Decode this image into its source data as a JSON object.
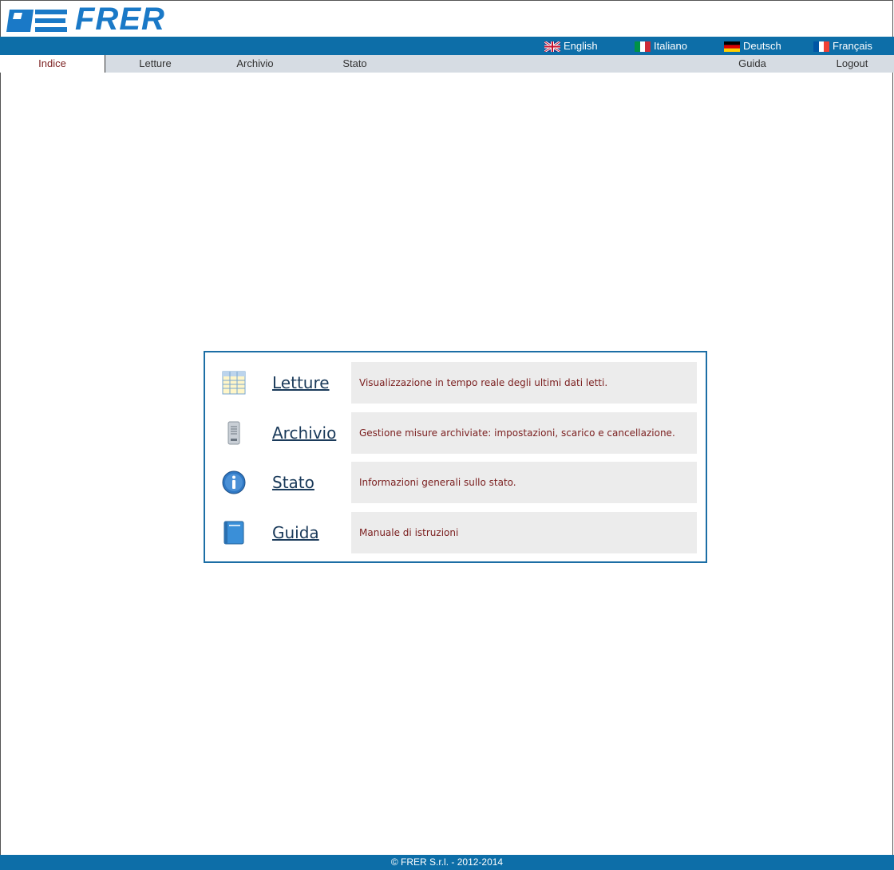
{
  "brand": {
    "logo_text": "FRER"
  },
  "languages": [
    {
      "label": "English"
    },
    {
      "label": "Italiano"
    },
    {
      "label": "Deutsch"
    },
    {
      "label": "Français"
    }
  ],
  "nav": {
    "left": [
      "Indice",
      "Letture",
      "Archivio",
      "Stato"
    ],
    "right": [
      "Guida",
      "Logout"
    ],
    "active": "Indice"
  },
  "menu": [
    {
      "title": "Letture",
      "description": "Visualizzazione in tempo reale degli ultimi dati letti.",
      "icon": "table-icon"
    },
    {
      "title": "Archivio",
      "description": "Gestione misure archiviate: impostazioni, scarico e cancellazione.",
      "icon": "server-icon"
    },
    {
      "title": "Stato",
      "description": "Informazioni generali sullo stato.",
      "icon": "info-icon"
    },
    {
      "title": "Guida",
      "description": "Manuale di istruzioni",
      "icon": "book-icon"
    }
  ],
  "footer": {
    "text": "© FRER S.r.l. - 2012-2014"
  },
  "colors": {
    "accent": "#0d6ea8",
    "nav_bg": "#d6dce3",
    "desc_text": "#7a1e1e"
  }
}
